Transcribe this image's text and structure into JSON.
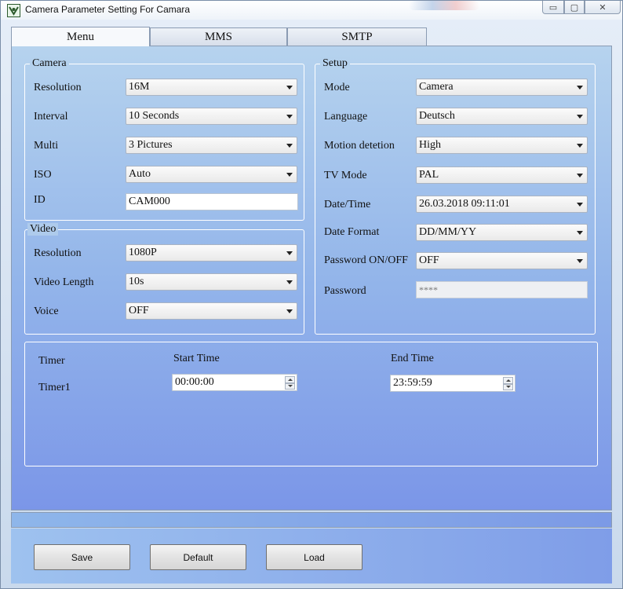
{
  "window": {
    "title": "Camera Parameter Setting For  Camara",
    "minimize_glyph": "▭",
    "maximize_glyph": "▢",
    "close_glyph": "✕"
  },
  "tabs": [
    {
      "label": "Menu"
    },
    {
      "label": "MMS"
    },
    {
      "label": "SMTP"
    }
  ],
  "camera": {
    "legend": "Camera",
    "resolution_label": "Resolution",
    "resolution_value": "16M",
    "interval_label": "Interval",
    "interval_value": "10 Seconds",
    "multi_label": "Multi",
    "multi_value": "3 Pictures",
    "iso_label": "ISO",
    "iso_value": "Auto",
    "id_label": "ID",
    "id_value": "CAM000"
  },
  "video": {
    "legend": "Video",
    "resolution_label": "Resolution",
    "resolution_value": "1080P",
    "length_label": "Video Length",
    "length_value": "10s",
    "voice_label": "Voice",
    "voice_value": "OFF"
  },
  "setup": {
    "legend": "Setup",
    "mode_label": "Mode",
    "mode_value": "Camera",
    "language_label": "Language",
    "language_value": "Deutsch",
    "motion_label": "Motion detetion",
    "motion_value": "High",
    "tvmode_label": "TV Mode",
    "tvmode_value": "PAL",
    "datetime_label": "Date/Time",
    "datetime_value": "26.03.2018 09:11:01",
    "dateformat_label": "Date Format",
    "dateformat_value": "DD/MM/YY",
    "password_onoff_label": "Password ON/OFF",
    "password_onoff_value": "OFF",
    "password_label": "Password",
    "password_value": "****"
  },
  "timer": {
    "timer_label": "Timer",
    "start_label": "Start Time",
    "end_label": "End Time",
    "timer1_label": "Timer1",
    "timer1_start": "00:00:00",
    "timer1_end": "23:59:59"
  },
  "buttons": {
    "save": "Save",
    "default": "Default",
    "load": "Load"
  }
}
